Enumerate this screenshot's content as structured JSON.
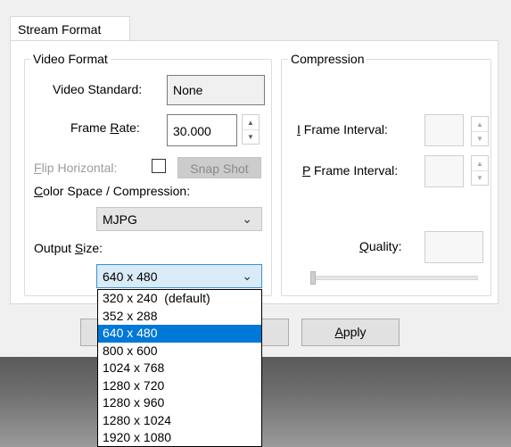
{
  "window": {
    "tab_label": "Stream Format"
  },
  "video_format": {
    "group_label": "Video Format",
    "video_standard_label": "Video Standard:",
    "video_standard_value": "None",
    "frame_rate_label_pre": "Frame ",
    "frame_rate_label_acc": "R",
    "frame_rate_label_post": "ate:",
    "frame_rate_value": "30.000",
    "flip_horizontal_label_acc": "F",
    "flip_horizontal_label_post": "lip Horizontal:",
    "snap_shot_label": "Snap Shot",
    "color_space_label_acc": "C",
    "color_space_label_post": "olor Space / Compression:",
    "color_space_value": "MJPG",
    "output_size_label_pre": "Output ",
    "output_size_label_acc": "S",
    "output_size_label_post": "ize:",
    "output_size_value": "640 x 480"
  },
  "compression": {
    "group_label": "Compression",
    "i_frame_label_acc": "I",
    "i_frame_label_post": " Frame Interval:",
    "p_frame_label_acc": "P",
    "p_frame_label_post": " Frame Interval:",
    "quality_label_acc": "Q",
    "quality_label_post": "uality:"
  },
  "buttons": {
    "apply_label_acc": "A",
    "apply_label_post": "pply"
  },
  "output_size_options": [
    "320 x 240  (default)",
    "352 x 288",
    "640 x 480",
    "800 x 600",
    "1024 x 768",
    "1280 x 720",
    "1280 x 960",
    "1280 x 1024",
    "1920 x 1080"
  ],
  "selected_option_index": 2,
  "icons": {
    "spin_up": "▲",
    "spin_down": "▼",
    "chevron": "⌄"
  }
}
